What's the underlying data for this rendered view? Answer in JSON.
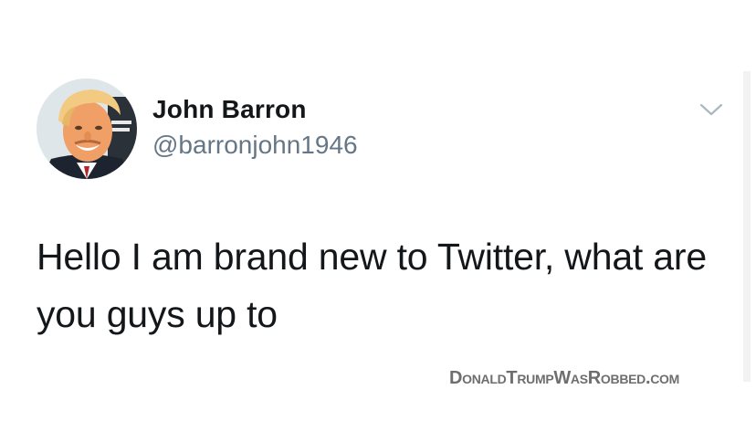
{
  "tweet": {
    "display_name": "John Barron",
    "handle": "@barronjohn1946",
    "text": "Hello I am brand new to Twitter, what are you guys up to"
  },
  "icons": {
    "menu": "chevron-down-icon",
    "avatar": "profile-photo"
  },
  "watermark": "DonaldTrumpWasRobbed.com",
  "colors": {
    "text": "#14171a",
    "handle": "#657786",
    "chevron": "#aab8c2",
    "watermark": "#6e6e6e"
  }
}
